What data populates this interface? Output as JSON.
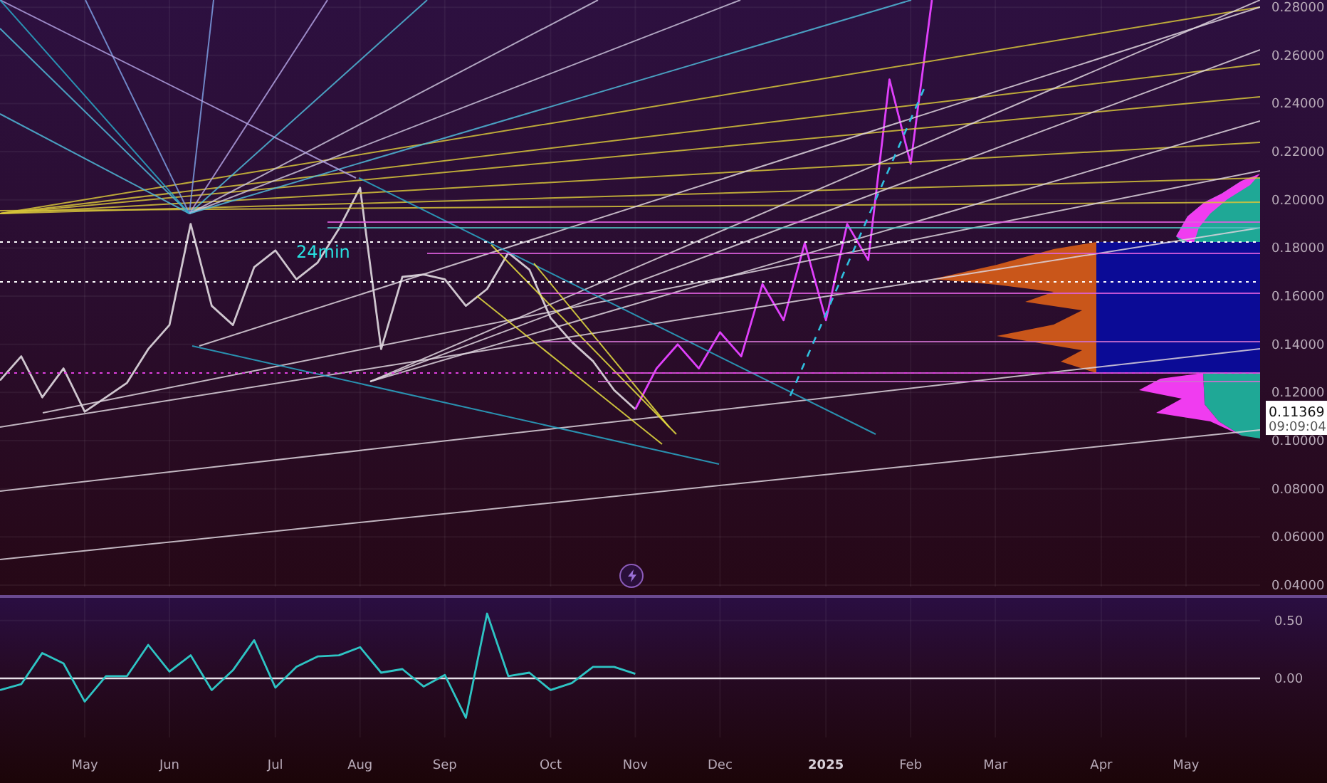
{
  "price_chart": {
    "chart_data": {
      "type": "line",
      "categories": [
        null,
        null,
        null,
        null,
        null,
        null,
        null,
        null,
        null,
        null,
        null,
        null,
        null,
        null,
        null,
        null,
        null,
        null,
        null,
        null,
        null,
        null,
        null,
        null,
        null,
        null,
        null,
        null,
        null,
        null,
        null,
        null,
        null,
        null,
        null,
        null,
        null,
        null,
        null,
        null,
        null,
        null,
        null,
        null,
        null,
        null,
        null,
        null,
        null,
        null,
        null,
        null,
        null,
        null,
        null,
        null,
        null,
        null,
        null,
        null
      ],
      "series": [
        {
          "color": "#cfc6cf",
          "values": [
            0.125,
            0.135,
            0.118,
            0.13,
            0.112,
            0.118,
            0.124,
            0.138,
            0.148,
            0.19,
            0.156,
            0.148,
            0.172,
            0.179,
            0.167,
            0.174,
            0.188,
            0.205,
            0.138,
            0.168,
            0.169,
            0.167,
            0.156,
            0.163,
            0.178,
            0.171,
            0.151,
            0.141,
            0.133,
            0.121,
            0.113,
            null,
            null,
            null,
            null,
            null,
            null,
            null,
            null,
            null,
            null,
            null,
            null,
            null,
            null,
            null,
            null,
            null,
            null,
            null,
            null,
            null,
            null,
            null,
            null,
            null,
            null,
            null,
            null,
            null
          ]
        },
        {
          "color": "#e040fb",
          "values": [
            null,
            null,
            null,
            null,
            null,
            null,
            null,
            null,
            null,
            null,
            null,
            null,
            null,
            null,
            null,
            null,
            null,
            null,
            null,
            null,
            null,
            null,
            null,
            null,
            null,
            null,
            null,
            null,
            null,
            null,
            0.113,
            0.13,
            0.14,
            0.13,
            0.145,
            0.135,
            0.165,
            0.15,
            0.182,
            0.15,
            0.19,
            0.175,
            0.25,
            0.215,
            0.283,
            null,
            null,
            null,
            null,
            null,
            null,
            null,
            null,
            null,
            null,
            null,
            null,
            null,
            null,
            null
          ]
        }
      ],
      "ylim": [
        0.0394,
        0.283
      ],
      "yticks": [
        {
          "value": 0.28,
          "label": "0.28000"
        },
        {
          "value": 0.26,
          "label": "0.26000"
        },
        {
          "value": 0.24,
          "label": "0.24000"
        },
        {
          "value": 0.22,
          "label": "0.22000"
        },
        {
          "value": 0.2,
          "label": "0.20000"
        },
        {
          "value": 0.18,
          "label": "0.18000"
        },
        {
          "value": 0.16,
          "label": "0.16000"
        },
        {
          "value": 0.14,
          "label": "0.14000"
        },
        {
          "value": 0.12,
          "label": "0.12000"
        },
        {
          "value": 0.1,
          "label": "0.10000"
        },
        {
          "value": 0.08,
          "label": "0.08000"
        },
        {
          "value": 0.06,
          "label": "0.06000"
        },
        {
          "value": 0.04,
          "label": "0.04000"
        }
      ],
      "grid": true
    },
    "note": "24min",
    "price_scale": {
      "last_price": "0.11369",
      "countdown": "09:09:04"
    }
  },
  "indicator_chart": {
    "chart_data": {
      "type": "line",
      "categories": [
        null,
        null,
        null,
        null,
        "May",
        null,
        null,
        null,
        "Jun",
        null,
        null,
        null,
        null,
        "Jul",
        null,
        null,
        null,
        "Aug",
        null,
        null,
        null,
        "Sep",
        null,
        null,
        null,
        null,
        "Oct",
        null,
        null,
        null,
        "Nov",
        null,
        null,
        null,
        "Dec",
        null,
        null,
        null,
        null,
        "2025",
        null,
        null,
        null,
        "Feb",
        null,
        null,
        null,
        "Mar",
        null,
        null,
        null,
        null,
        "Apr",
        null,
        null,
        null,
        "May",
        null,
        null,
        null
      ],
      "series": [
        {
          "color": "#2ec4c4",
          "values": [
            -0.1,
            -0.05,
            0.22,
            0.13,
            -0.2,
            0.02,
            0.02,
            0.29,
            0.06,
            0.2,
            -0.1,
            0.07,
            0.33,
            -0.08,
            0.1,
            0.19,
            0.2,
            0.27,
            0.05,
            0.08,
            -0.07,
            0.03,
            -0.34,
            0.56,
            0.02,
            0.05,
            -0.1,
            -0.04,
            0.1,
            0.1,
            0.04,
            null,
            null,
            null,
            null,
            null,
            null,
            null,
            null,
            null,
            null,
            null,
            null,
            null,
            null,
            null,
            null,
            null,
            null,
            null,
            null,
            null,
            null,
            null,
            null,
            null,
            null,
            null,
            null,
            null
          ]
        }
      ],
      "ylim": [
        -0.51,
        0.72
      ],
      "grid": true,
      "yticks": [
        {
          "value": 0.5,
          "label": "0.50"
        },
        {
          "value": 0,
          "label": "0.00"
        }
      ]
    }
  }
}
